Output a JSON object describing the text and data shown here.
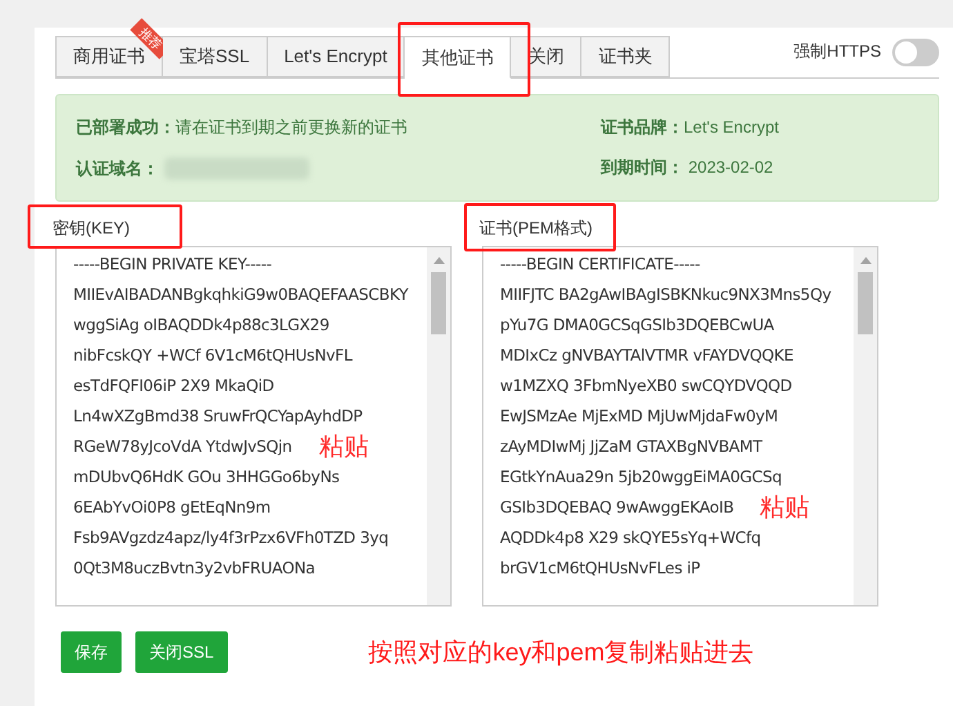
{
  "tabs": [
    {
      "label": "商用证书",
      "badge": "推荐",
      "selected": false
    },
    {
      "label": "宝塔SSL",
      "selected": false
    },
    {
      "label": "Let's Encrypt",
      "selected": false
    },
    {
      "label": "其他证书",
      "selected": true
    },
    {
      "label": "关闭",
      "selected": false
    },
    {
      "label": "证书夹",
      "selected": false
    }
  ],
  "force_https": {
    "label": "强制HTTPS",
    "on": false
  },
  "alert": {
    "status_label": "已部署成功：",
    "status_text": "请在证书到期之前更换新的证书",
    "domain_label": "认证域名：",
    "brand_label": "证书品牌：",
    "brand": "Let's Encrypt",
    "expiry_label": "到期时间：",
    "expiry": "2023-02-02"
  },
  "key": {
    "label": "密钥(KEY)",
    "lines": [
      "-----BEGIN PRIVATE KEY-----",
      "MIIEvAIBADANBgkqhkiG9w0BAQEFAASCBKY",
      "wggSiAg oIBAQDDk4p88c3LGX29",
      "nibFcskQY +WCf 6V1cM6tQHUsNvFL",
      "esTdFQFI06iP 2X9 MkaQiD",
      "Ln4wXZgBmd38 SruwFrQCYapAyhdDP",
      "RGeW78yJcoVdA YtdwJvSQjn",
      "mDUbvQ6HdK GOu 3HHGGo6byNs",
      "6EAbYvOi0P8 gEtEqNn9m",
      "Fsb9AVgzdz4apz/ly4f3rPzx6VFh0TZD 3yq",
      "0Qt3M8uczBvtn3y2vbFRUAONa"
    ]
  },
  "cert": {
    "label": "证书(PEM格式)",
    "lines": [
      "-----BEGIN CERTIFICATE-----",
      "MIIFJTC BA2gAwIBAgISBKNkuc9NX3Mns5Qy",
      "pYu7G DMA0GCSqGSIb3DQEBCwUA",
      "MDIxCz gNVBAYTAlVTMR vFAYDVQQKE",
      "w1MZXQ 3FbmNyeXB0 swCQYDVQQD",
      "EwJSMzAe MjExMD MjUwMjdaFw0yM",
      "zAyMDIwMj JjZaM GTAXBgNVBAMT",
      "EGtkYnAua29n 5jb20wggEiMA0GCSq",
      "GSIb3DQEBAQ 9wAwggEKAoIB",
      "AQDDk4p8 X29 skQYE5sYq+WCfq",
      "brGV1cM6tQHUsNvFLes iP"
    ]
  },
  "buttons": [
    {
      "label": "保存"
    },
    {
      "label": "关闭SSL"
    }
  ],
  "annotations": {
    "paste_key": "粘贴",
    "paste_cert": "粘贴",
    "note": "按照对应的key和pem复制粘贴进去"
  }
}
